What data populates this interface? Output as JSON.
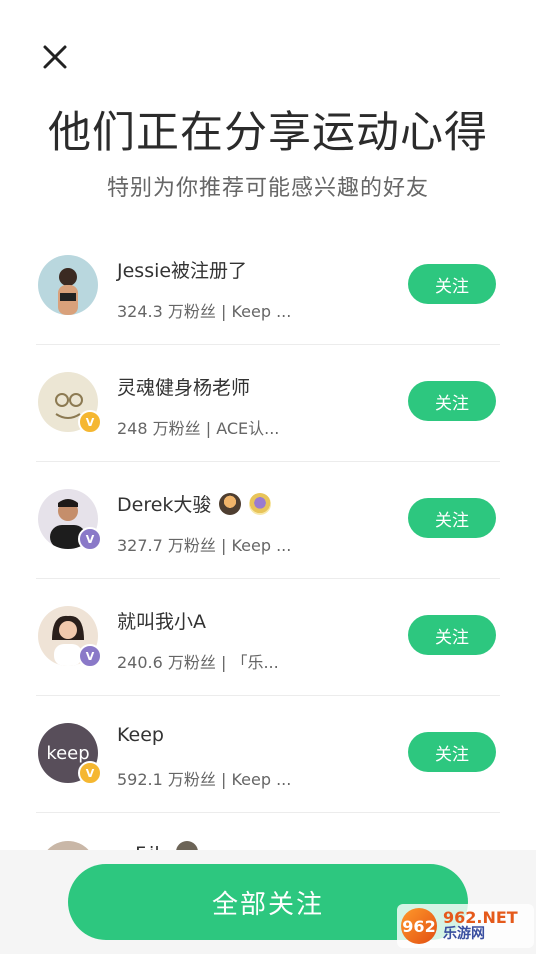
{
  "header": {
    "close_icon": "close-icon",
    "title": "他们正在分享运动心得",
    "subtitle": "特别为你推荐可能感兴趣的好友"
  },
  "users": [
    {
      "name": "Jessie被注册了",
      "meta": "324.3 万粉丝 | Keep ...",
      "follow": "关注",
      "badge": "",
      "badge_color": ""
    },
    {
      "name": "灵魂健身杨老师",
      "meta": "248 万粉丝 | ACE认...",
      "follow": "关注",
      "badge": "V",
      "badge_color": "#f5b731"
    },
    {
      "name": "Derek大骏",
      "meta": "327.7 万粉丝 | Keep ...",
      "follow": "关注",
      "badge": "V",
      "badge_color": "#8a79c8"
    },
    {
      "name": "就叫我小A",
      "meta": "240.6 万粉丝 | 「乐...",
      "follow": "关注",
      "badge": "V",
      "badge_color": "#8a79c8"
    },
    {
      "name": "Keep",
      "meta": "592.1 万粉丝 | Keep ...",
      "follow": "关注",
      "badge": "V",
      "badge_color": "#f5b731",
      "avatar_text": "keep"
    }
  ],
  "partial_row": {
    "name_fragment": "...F.il"
  },
  "footer": {
    "follow_all": "全部关注"
  },
  "watermark": {
    "logo_text": "962",
    "line1": "962.NET",
    "line2": "乐游网"
  },
  "colors": {
    "accent_green": "#2dc77f",
    "background": "#ffffff",
    "footer_bg": "#f5f5f5"
  }
}
